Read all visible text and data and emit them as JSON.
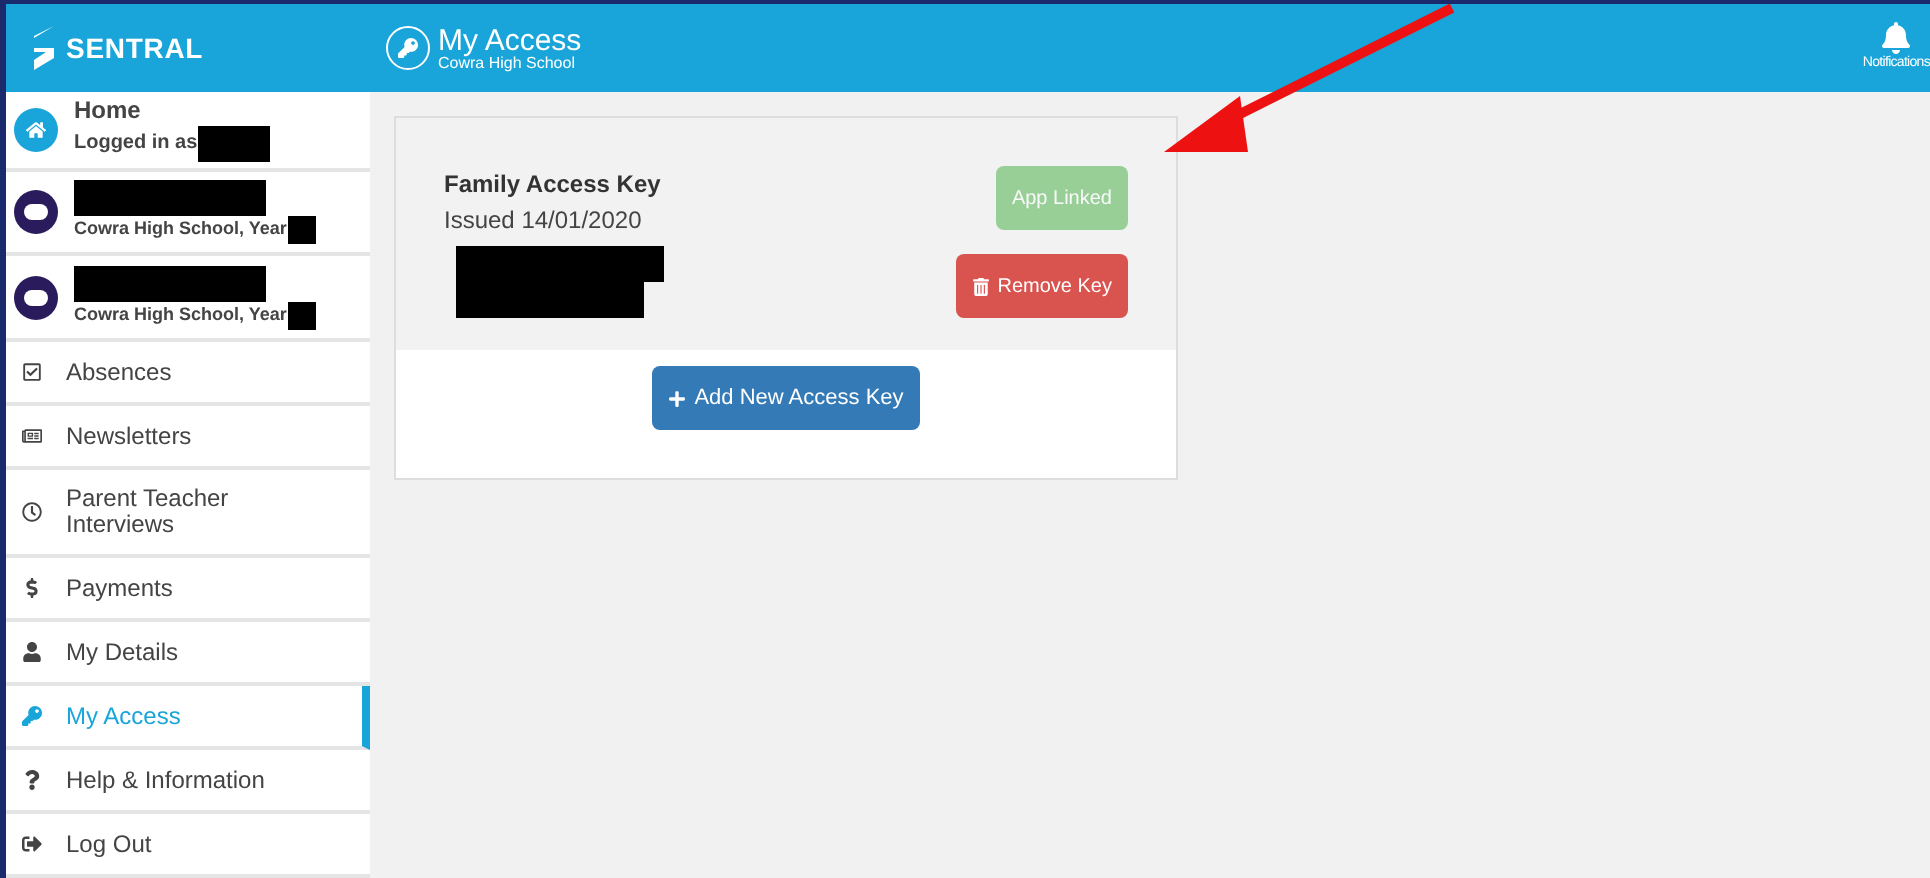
{
  "header": {
    "logo": "SENTRAL",
    "title": "My Access",
    "subtitle": "Cowra High School",
    "notifications": "Notifications"
  },
  "home": {
    "title": "Home",
    "subtitle": "Logged in as"
  },
  "students": [
    {
      "subtitle": "Cowra High School, Year"
    },
    {
      "subtitle": "Cowra High School, Year"
    }
  ],
  "nav": [
    {
      "label": "Absences",
      "selected": false
    },
    {
      "label": "Newsletters",
      "selected": false
    },
    {
      "label": "Parent Teacher Interviews",
      "selected": false
    },
    {
      "label": "Payments",
      "selected": false
    },
    {
      "label": "My Details",
      "selected": false
    },
    {
      "label": "My Access",
      "selected": true
    },
    {
      "label": "Help & Information",
      "selected": false
    },
    {
      "label": "Log Out",
      "selected": false
    }
  ],
  "key_card": {
    "title": "Family Access Key",
    "issued": "Issued 14/01/2020",
    "buttons": [
      {
        "label": "App Linked",
        "kind": "linked",
        "disabled": true
      },
      {
        "label": "Remove Key",
        "kind": "remove",
        "disabled": false
      }
    ],
    "add_button": "Add New Access Key"
  }
}
